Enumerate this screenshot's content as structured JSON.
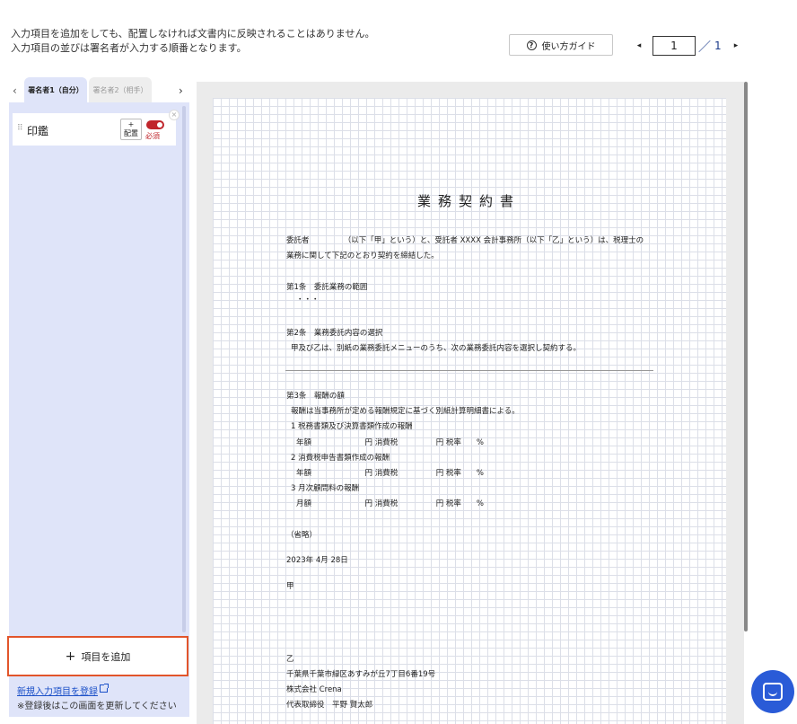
{
  "notice": {
    "line1": "入力項目を追加をしても、配置しなければ文書内に反映されることはありません。",
    "line2": "入力項目の並びは署名者が入力する順番となります。"
  },
  "toolbar": {
    "guide_label": "使い方ガイド",
    "guide_icon": "question-circle-icon",
    "page_current": "1",
    "page_separator": "／",
    "page_total": "1",
    "prev_icon": "◂",
    "next_icon": "▸"
  },
  "signer_tabs": {
    "prev_icon": "‹",
    "next_icon": "›",
    "tabs": [
      {
        "label": "署名者1（自分）",
        "active": true
      },
      {
        "label": "署名者2（相手）",
        "active": false
      }
    ]
  },
  "fields": {
    "items": [
      {
        "label": "印鑑",
        "place_label_top": "+",
        "place_label_bottom": "配置",
        "required_label": "必須",
        "required": true
      }
    ],
    "remove_icon": "×",
    "drag_icon": "⠿"
  },
  "actions": {
    "add_label": "項目を追加",
    "add_icon": "+",
    "new_link": "新規入力項目を登録",
    "note": "※登録後はこの画面を更新してください"
  },
  "document": {
    "title": "業務契約書",
    "lines": {
      "l1": "委託者　　　　　（以下「甲」という）と、受託者 XXXX 会計事務所（以下「乙」という）は、税理士の",
      "l2": "業務に関して下記のとおり契約を締結した。",
      "l3": "第1条　委託業務の範囲",
      "l4": "・・・",
      "l5": "第2条　業務委託内容の選択",
      "l6": "甲及び乙は、別紙の業務委託メニューのうち、次の業務委託内容を選択し契約する。",
      "l7": "第3条　報酬の額",
      "l8": "報酬は当事務所が定める報酬規定に基づく別紙計算明細書による。",
      "l9": "1 税務書類及び決算書類作成の報酬",
      "l10": "年額　　　　　　　円 消費税　　　　　円 税率　　%",
      "l11": "2 消費税申告書類作成の報酬",
      "l12": "年額　　　　　　　円 消費税　　　　　円 税率　　%",
      "l13": "3 月次顧問料の報酬",
      "l14": "月額　　　　　　　円 消費税　　　　　円 税率　　%",
      "l15": "（省略）",
      "l16": "2023年 4月 28日",
      "l17": "甲",
      "l18": "乙",
      "l19": "千葉県千葉市緑区あすみが丘7丁目6番19号",
      "l20": "株式会社 Crena",
      "l21": "代表取締役　平野 賢太郎"
    }
  },
  "colors": {
    "accent": "#2a5bd7",
    "panel": "#dfe4f9",
    "highlight": "#e2552b",
    "required": "#c0252b"
  }
}
